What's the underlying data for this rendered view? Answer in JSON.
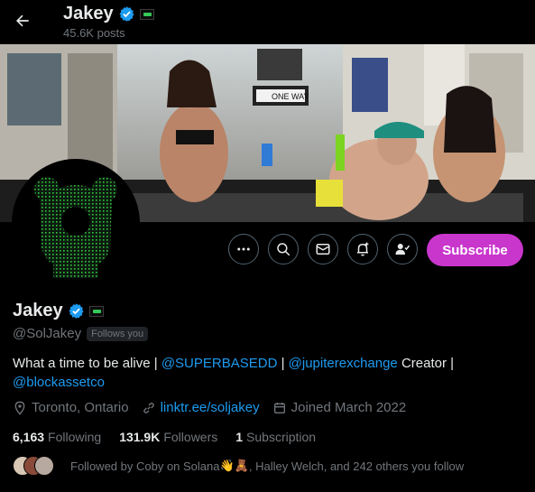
{
  "header": {
    "back_icon": "arrow-left-icon",
    "title": "Jakey",
    "posts_count": "45.6K posts"
  },
  "banner": {
    "sign_text": "ONE WAY"
  },
  "actions": {
    "more_icon": "more-horizontal-icon",
    "search_icon": "search-icon",
    "message_icon": "mail-icon",
    "notify_icon": "bell-plus-icon",
    "follow_icon": "person-check-icon",
    "subscribe_label": "Subscribe"
  },
  "profile": {
    "display_name": "Jakey",
    "handle": "@SolJakey",
    "follows_you": "Follows you",
    "bio_text_1": "What a time to be alive | ",
    "bio_link_1": "@SUPERBASEDD",
    "bio_sep": " | ",
    "bio_link_2": "@jupiterexchange",
    "bio_text_2": " Creator |",
    "bio_link_3": "@blockassetco",
    "location": "Toronto, Ontario",
    "website": "linktr.ee/soljakey",
    "joined": "Joined March 2022"
  },
  "stats": {
    "following_count": "6,163",
    "following_label": "Following",
    "followers_count": "131.9K",
    "followers_label": "Followers",
    "subscriptions_count": "1",
    "subscriptions_label": "Subscription"
  },
  "followed_by": {
    "text_1": "Followed by Coby on Solana ",
    "emoji": "👋🧸",
    "text_2": ", Halley Welch, and 242 others you follow"
  },
  "colors": {
    "accent": "#1d9bf0",
    "subscribe": "#c936cc",
    "verified": "#1d9bf0",
    "muted": "#71767b",
    "avatar_pattern": "#2ecc40"
  }
}
